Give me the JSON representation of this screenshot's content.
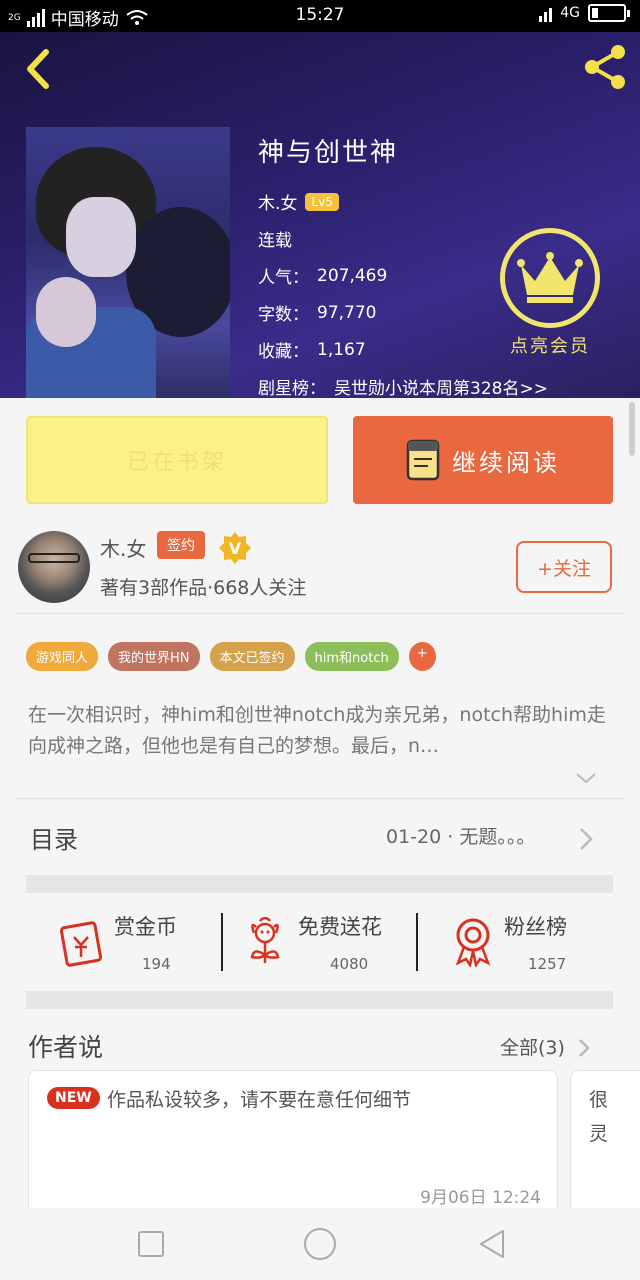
{
  "status_bar": {
    "network": "2G",
    "carrier": "中国移动",
    "time": "15:27",
    "data_badge": "4G"
  },
  "book": {
    "title": "神与创世神",
    "author": "木.女",
    "level": "Lv5",
    "status": "连载",
    "popularity_label": "人气：",
    "popularity": "207,469",
    "words_label": "字数：",
    "words": "97,770",
    "favorites_label": "收藏：",
    "favorites": "1,167",
    "rank_label": "剧星榜：",
    "rank_text": "吴世勋小说本周第328名>>"
  },
  "vip": {
    "label": "点亮会员",
    "icon": "crown-icon"
  },
  "actions": {
    "shelf_label": "已在书架",
    "read_label": "继续阅读"
  },
  "author_card": {
    "name": "木.女",
    "signed_badge": "签约",
    "verified_badge": "V",
    "subtitle": "著有3部作品·668人关注",
    "follow_label": "+关注"
  },
  "tags": [
    {
      "label": "游戏同人",
      "color": "#f0a93b"
    },
    {
      "label": "我的世界HN",
      "color": "#c07560"
    },
    {
      "label": "本文已签约",
      "color": "#d5a14a"
    },
    {
      "label": "him和notch",
      "color": "#8cbf5a"
    },
    {
      "label": "+",
      "color": "#e9683f"
    }
  ],
  "description": "在一次相识时，神him和创世神notch成为亲兄弟，notch帮助him走向成神之路，但他也是有自己的梦想。最后，n…",
  "toc": {
    "label": "目录",
    "latest": "01-20 · 无题。。。"
  },
  "stats": [
    {
      "name": "赏金币",
      "value": "194",
      "icon": "red-envelope-icon"
    },
    {
      "name": "免费送花",
      "value": "4080",
      "icon": "flower-icon"
    },
    {
      "name": "粉丝榜",
      "value": "1257",
      "icon": "medal-icon"
    }
  ],
  "author_talk": {
    "heading": "作者说",
    "all_label": "全部(3)",
    "new_badge": "NEW",
    "post_text": "作品私设较多，请不要在意任何细节",
    "post_date": "9月06日  12:24",
    "next_preview": "很灵"
  }
}
